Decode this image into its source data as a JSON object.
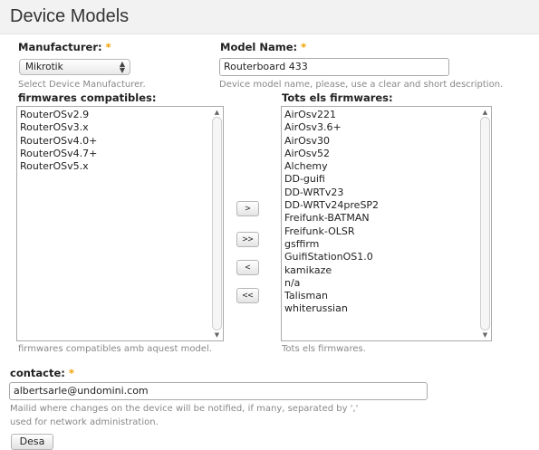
{
  "page": {
    "title": "Device Models"
  },
  "manufacturer": {
    "label": "Manufacturer:",
    "required_mark": "*",
    "selected": "Mikrotik",
    "help": "Select Device Manufacturer."
  },
  "model_name": {
    "label": "Model Name:",
    "required_mark": "*",
    "value": "Routerboard 433",
    "help": "Device model name, please, use a clear and short description."
  },
  "compatible_firmwares": {
    "label": "firmwares compatibles:",
    "items": [
      "RouterOSv2.9",
      "RouterOSv3.x",
      "RouterOSv4.0+",
      "RouterOSv4.7+",
      "RouterOSv5.x"
    ],
    "help": "firmwares compatibles amb aquest model."
  },
  "all_firmwares": {
    "label": "Tots els firmwares:",
    "items": [
      "AirOsv221",
      "AirOsv3.6+",
      "AirOsv30",
      "AirOsv52",
      "Alchemy",
      "DD-guifi",
      "DD-WRTv23",
      "DD-WRTv24preSP2",
      "Freifunk-BATMAN",
      "Freifunk-OLSR",
      "gsffirm",
      "GuifiStationOS1.0",
      "kamikaze",
      "n/a",
      "Talisman",
      "whiterussian"
    ],
    "help": "Tots els firmwares."
  },
  "move_buttons": {
    "add": ">",
    "add_all": ">>",
    "remove": "<",
    "remove_all": "<<"
  },
  "contact": {
    "label": "contacte:",
    "required_mark": "*",
    "value": "albertsarle@undomini.com",
    "help_line1": "Mailid where changes on the device will be notified, if many, separated by ','",
    "help_line2": "used for network administration."
  },
  "submit": {
    "label": "Desa"
  },
  "icons": {
    "select_arrows": "up-down-arrows-icon",
    "scroll_up": "scroll-up-arrow-icon",
    "scroll_down": "scroll-down-arrow-icon"
  }
}
